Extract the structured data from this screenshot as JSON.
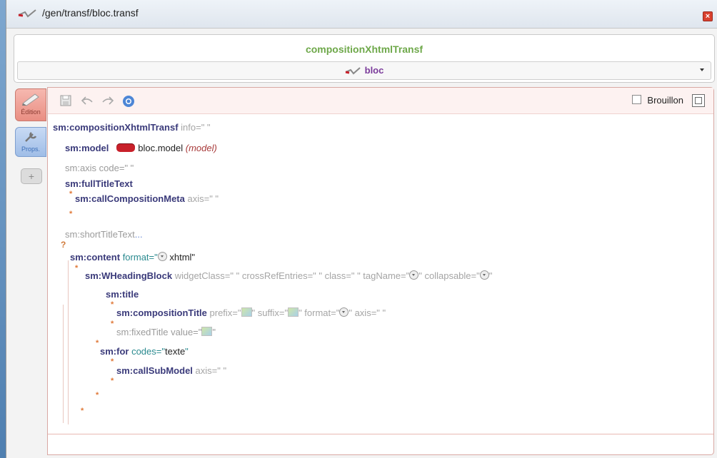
{
  "window": {
    "title": "/gen/transf/bloc.transf",
    "close_label": "×"
  },
  "header": {
    "title": "compositionXhtmlTransf",
    "model_value": "bloc"
  },
  "side_tabs": {
    "edition_label": "Édition",
    "props_label": "Props.",
    "add_label": "+"
  },
  "toolbar": {
    "draft_label": "Brouillon"
  },
  "tree": {
    "l1_kw": "sm:compositionXhtmlTransf",
    "l1_attr": "info=\" \"",
    "l2_kw": "sm:model",
    "l2_val": "bloc.model",
    "l2_note": "(model)",
    "l3_text": "sm:axis code=\"  \"",
    "l4_kw": "sm:fullTitleText",
    "l5_kw": "sm:callCompositionMeta",
    "l5_attr": "axis=\"  \"",
    "l6_text": "sm:shortTitleText",
    "l6_dots": "...",
    "l7_kw": "sm:content",
    "l7_attr": "format=\"",
    "l7_val": "xhtml\"",
    "l8_kw": "sm:WHeadingBlock",
    "l8_attr1": "widgetClass=\" \"  crossRefEntries=\" \"  class=\" \"  tagName=\"",
    "l8_attr2": "\"  collapsable=\"",
    "l8_attr3": "\"",
    "l9_kw": "sm:title",
    "l10_kw": "sm:compositionTitle",
    "l10_attr1": "prefix=\"",
    "l10_attr2": "\"  suffix=\"",
    "l10_attr3": "\"  format=\"",
    "l10_attr4": "\"  axis=\"  \"",
    "l11_text": "sm:fixedTitle value=\"",
    "l11_end": "\"",
    "l12_kw": "sm:for",
    "l12_attr": "codes=\"",
    "l12_val": "texte",
    "l12_end": "\"",
    "l13_kw": "sm:callSubModel",
    "l13_attr": "axis=\"  \"",
    "qmark": "?",
    "star": "*"
  },
  "colors": {
    "header_green": "#6ea84a",
    "model_purple": "#7a3a9a",
    "edition_tab": "#e98e82",
    "props_tab": "#9fbde7"
  }
}
